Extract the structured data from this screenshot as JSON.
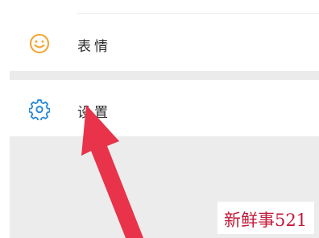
{
  "menu": {
    "items": [
      {
        "label": "表情",
        "icon": "smiley-icon"
      },
      {
        "label": "设置",
        "icon": "gear-icon"
      }
    ]
  },
  "annotation": {
    "watermark": "新鲜事521",
    "arrow_color": "#e8334a"
  },
  "colors": {
    "icon_accent_expr": "#f5a12b",
    "icon_accent_settings": "#2b8bd8"
  }
}
